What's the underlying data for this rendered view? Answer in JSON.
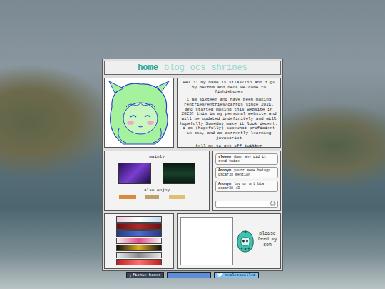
{
  "nav": [
    {
      "label": "home",
      "selected": true
    },
    {
      "label": "blog",
      "selected": false
    },
    {
      "label": "ocs",
      "selected": false
    },
    {
      "label": "shrines",
      "selected": false
    }
  ],
  "intro": {
    "greeting": "HAI !! my name is silas/lio and i go by he/him and neos welcome to fishiebones",
    "about": "i am sixteen and have been making rentries/entries/carrds since 2021, and started making this website in 2025! this is my personal website and will be updated indefinitely and will hopefully Someday make it look decent. i am (hopefully) somewhat proficient in css, and am currently learning javascript",
    "footer": "tell me to get off twitter"
  },
  "mainly": {
    "heading": "mainly",
    "subheading": "also enjoy"
  },
  "chat": {
    "messages": [
      {
        "name": "sleeep",
        "text": "damn why did it send twice"
      },
      {
        "name": "Anonym",
        "text": "yourr meme beingy oscar38 mention"
      },
      {
        "name": "Anonym",
        "text": "luv ur art btw oscar38 :3"
      }
    ],
    "emoji_button": "☺"
  },
  "pet": {
    "caption": "please feed my son"
  },
  "badges": [
    {
      "kind": "tumblr",
      "icon": "t",
      "label": "fishie-bones",
      "color": "#35465c"
    },
    {
      "kind": "plain",
      "icon": "",
      "label": "",
      "color": "#5b8fd9"
    },
    {
      "kind": "twitter",
      "icon": "",
      "label": "neolesspilled",
      "color": "#7fc0ee"
    }
  ]
}
